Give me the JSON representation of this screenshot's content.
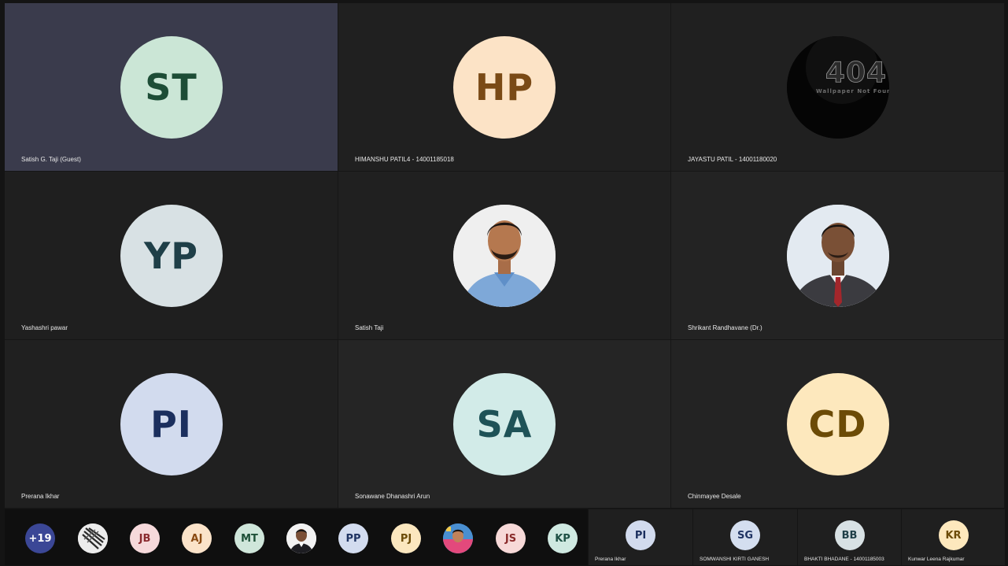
{
  "grid": {
    "tiles": [
      {
        "name": "Satish G. Taji (Guest)",
        "initials": "ST",
        "bg": "#3a3b4c",
        "avatar_bg": "#cbe6d6",
        "avatar_fg": "#1d4d36",
        "type": "initials"
      },
      {
        "name": "HIMANSHU PATIL4 - 14001185018",
        "initials": "HP",
        "bg": "#202020",
        "avatar_bg": "#fce3c6",
        "avatar_fg": "#7a4a16",
        "type": "initials"
      },
      {
        "name": "JAYASTU PATIL - 14001180020",
        "initials": "",
        "bg": "#202020",
        "avatar_bg": "#050505",
        "type": "image-404",
        "image_text": "404",
        "image_subtext": "Wallpaper Not Found"
      },
      {
        "name": "Yashashri pawar",
        "initials": "YP",
        "bg": "#1f1f1f",
        "avatar_bg": "#d8e1e4",
        "avatar_fg": "#1f3f48",
        "type": "initials"
      },
      {
        "name": "Satish Taji",
        "initials": "",
        "bg": "#202020",
        "avatar_bg": "#eeeeee",
        "type": "photo-man-blue-shirt"
      },
      {
        "name": "Shrikant Randhavane (Dr.)",
        "initials": "",
        "bg": "#232323",
        "avatar_bg": "#dfe7ef",
        "type": "photo-man-suit"
      },
      {
        "name": "Prerana Ikhar",
        "initials": "PI",
        "bg": "#202020",
        "avatar_bg": "#d2dbee",
        "avatar_fg": "#1b2f5e",
        "type": "initials"
      },
      {
        "name": "Sonawane Dhanashri Arun",
        "initials": "SA",
        "bg": "#252525",
        "avatar_bg": "#d2ebe8",
        "avatar_fg": "#1e5257",
        "type": "initials"
      },
      {
        "name": "Chinmayee Desale",
        "initials": "CD",
        "bg": "#232323",
        "avatar_bg": "#fde8bd",
        "avatar_fg": "#6c4b06",
        "type": "initials"
      }
    ]
  },
  "overflow": {
    "more_count": "+19",
    "avatars": [
      {
        "label": "+19",
        "bg": "#3b4796",
        "fg": "#ffffff",
        "type": "text"
      },
      {
        "label": "",
        "bg": "#e8e8e8",
        "type": "pattern"
      },
      {
        "label": "JB",
        "bg": "#f6d9db",
        "fg": "#8a2a2f",
        "type": "text"
      },
      {
        "label": "AJ",
        "bg": "#fbe3c9",
        "fg": "#8a4a12",
        "type": "text"
      },
      {
        "label": "MT",
        "bg": "#cfe6da",
        "fg": "#1d5037",
        "type": "text"
      },
      {
        "label": "",
        "bg": "#f2f2f2",
        "type": "photo-suit"
      },
      {
        "label": "PP",
        "bg": "#d3dcef",
        "fg": "#203463",
        "type": "text"
      },
      {
        "label": "PJ",
        "bg": "#fbe7bf",
        "fg": "#6c4c08",
        "type": "text"
      },
      {
        "label": "",
        "bg": "#4a8fd1",
        "type": "photo-colorful"
      },
      {
        "label": "JS",
        "bg": "#f7d9d8",
        "fg": "#8a2b2b",
        "type": "text"
      },
      {
        "label": "KP",
        "bg": "#cfe9e1",
        "fg": "#1d5044",
        "type": "text"
      }
    ]
  },
  "strip_tiles": [
    {
      "name": "Prerana Ikhar",
      "initials": "PI",
      "avatar_bg": "#d2dbee",
      "avatar_fg": "#1b2f5e"
    },
    {
      "name": "SOMWANSHI KIRTI GANESH",
      "initials": "SG",
      "avatar_bg": "#d4deef",
      "avatar_fg": "#203463"
    },
    {
      "name": "BHAKTI BHADANE - 14001185003",
      "initials": "BB",
      "avatar_bg": "#d8e1e4",
      "avatar_fg": "#1f3f48"
    },
    {
      "name": "Kunwar Leena Rajkumar",
      "initials": "KR",
      "avatar_bg": "#fde8bd",
      "avatar_fg": "#6c4b06"
    }
  ]
}
